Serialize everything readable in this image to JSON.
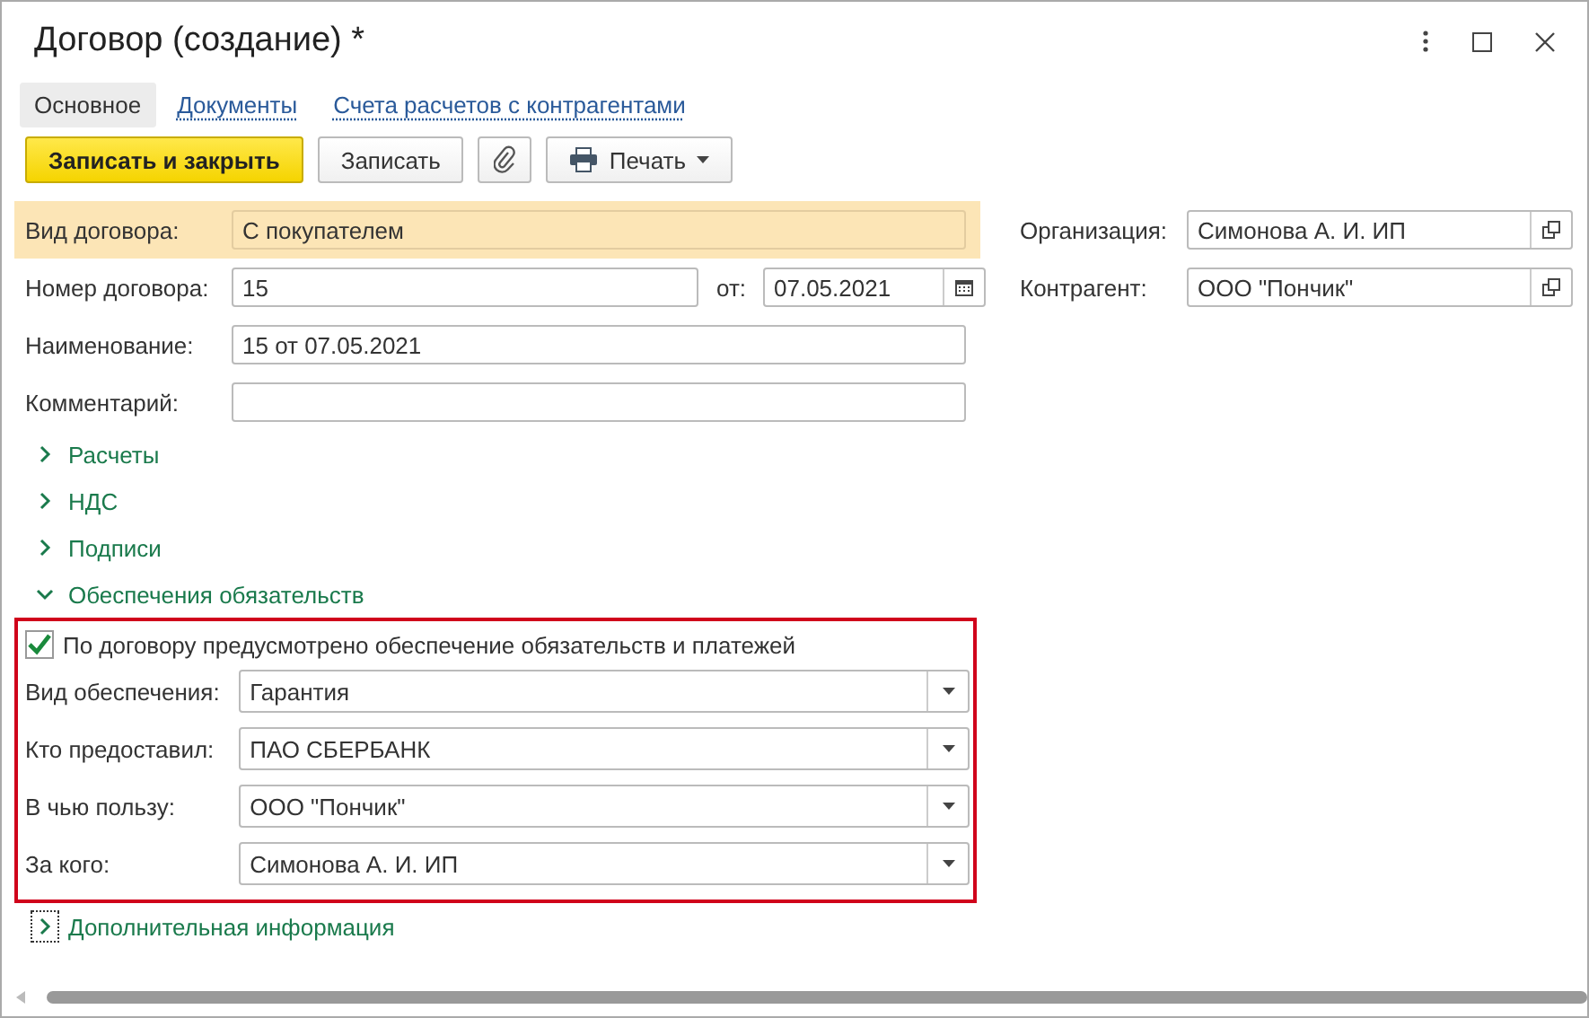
{
  "window": {
    "title": "Договор (создание) *"
  },
  "tabs": [
    {
      "label": "Основное",
      "selected": true
    },
    {
      "label": "Документы",
      "selected": false
    },
    {
      "label": "Счета расчетов с контрагентами",
      "selected": false
    }
  ],
  "toolbar": [
    {
      "kind": "primary",
      "label": "Записать и закрыть"
    },
    {
      "kind": "plain",
      "label": "Записать"
    },
    {
      "kind": "attach"
    },
    {
      "kind": "menu",
      "label": "Печать"
    }
  ],
  "contract_type": {
    "label": "Вид договора:",
    "value": "С покупателем"
  },
  "number": {
    "label": "Номер договора:",
    "value": "15"
  },
  "date": {
    "label": "от:",
    "value": "07.05.2021"
  },
  "name": {
    "label": "Наименование:",
    "value": "15 от 07.05.2021"
  },
  "comment": {
    "label": "Комментарий:"
  },
  "organization": {
    "label": "Организация:",
    "value": "Симонова А. И. ИП"
  },
  "counterparty": {
    "label": "Контрагент:",
    "value": "ООО \"Пончик\""
  },
  "groups": [
    {
      "title": "Расчеты",
      "expanded": false,
      "focused": false
    },
    {
      "title": "НДС",
      "expanded": false,
      "focused": false
    },
    {
      "title": "Подписи",
      "expanded": false,
      "focused": false
    },
    {
      "title": "Обеспечения обязательств",
      "expanded": true,
      "focused": false,
      "security": {
        "checkbox": {
          "label": "По договору предусмотрено обеспечение обязательств и платежей",
          "checked": true
        },
        "fields": [
          {
            "label": "Вид обеспечения:",
            "value": "Гарантия"
          },
          {
            "label": "Кто предоставил:",
            "value": "ПАО СБЕРБАНК"
          },
          {
            "label": "В чью пользу:",
            "value": "ООО \"Пончик\""
          },
          {
            "label": "За кого:",
            "value": "Симонова А. И. ИП"
          }
        ]
      }
    },
    {
      "title": "Дополнительная информация",
      "expanded": false,
      "focused": true
    }
  ]
}
